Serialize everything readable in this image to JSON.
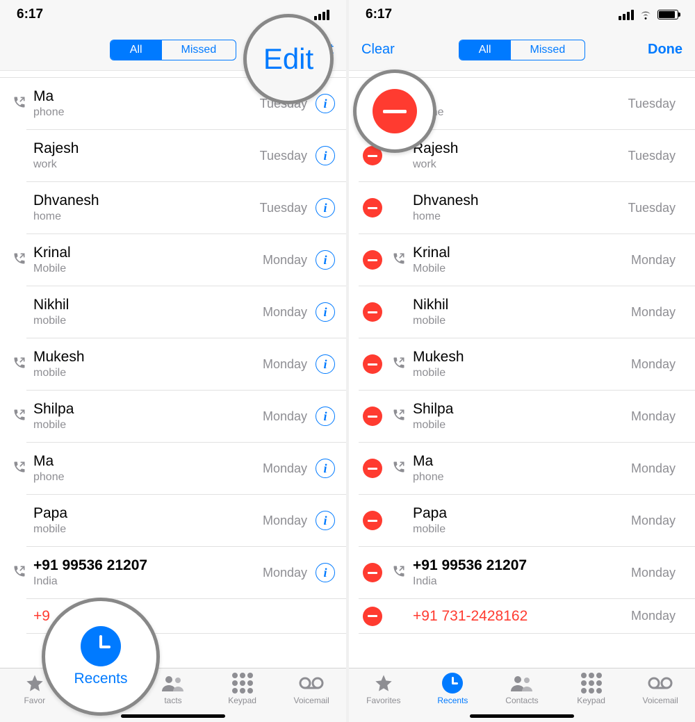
{
  "left": {
    "time": "6:17",
    "header": {
      "edit": "Edit",
      "seg_all": "All",
      "seg_missed": "Missed"
    },
    "rows": [
      {
        "name": "Ma",
        "sub": "phone",
        "day": "Tuesday",
        "icon": true,
        "missed": false,
        "info": true
      },
      {
        "name": "Rajesh",
        "sub": "work",
        "day": "Tuesday",
        "icon": false,
        "missed": false,
        "info": true
      },
      {
        "name": "Dhvanesh",
        "sub": "home",
        "day": "Tuesday",
        "icon": false,
        "missed": false,
        "info": true
      },
      {
        "name": "Krinal",
        "sub": "Mobile",
        "day": "Monday",
        "icon": true,
        "missed": false,
        "info": true
      },
      {
        "name": "Nikhil",
        "sub": "mobile",
        "day": "Monday",
        "icon": false,
        "missed": false,
        "info": true
      },
      {
        "name": "Mukesh",
        "sub": "mobile",
        "day": "Monday",
        "icon": true,
        "missed": false,
        "info": true
      },
      {
        "name": "Shilpa",
        "sub": "mobile",
        "day": "Monday",
        "icon": true,
        "missed": false,
        "info": true
      },
      {
        "name": "Ma",
        "sub": "phone",
        "day": "Monday",
        "icon": true,
        "missed": false,
        "info": true
      },
      {
        "name": "Papa",
        "sub": "mobile",
        "day": "Monday",
        "icon": false,
        "missed": false,
        "info": true
      },
      {
        "name": "+91 99536 21207",
        "sub": "India",
        "day": "Monday",
        "icon": true,
        "missed": false,
        "bold": true,
        "info": true
      },
      {
        "name": "+9",
        "sub": "",
        "day": "",
        "icon": false,
        "missed": true,
        "partial": true
      }
    ],
    "tabs": {
      "favorites": "Favor",
      "recents": "Recents",
      "contacts": "tacts",
      "keypad": "Keypad",
      "voicemail": "Voicemail"
    }
  },
  "right": {
    "time": "6:17",
    "header": {
      "clear": "Clear",
      "done": "Done",
      "seg_all": "All",
      "seg_missed": "Missed"
    },
    "rows": [
      {
        "name": "Ma",
        "sub": "phone",
        "day": "Tuesday",
        "icon": true,
        "remain": true
      },
      {
        "name": "Rajesh",
        "sub": "work",
        "day": "Tuesday",
        "icon": false
      },
      {
        "name": "Dhvanesh",
        "sub": "home",
        "day": "Tuesday",
        "icon": false
      },
      {
        "name": "Krinal",
        "sub": "Mobile",
        "day": "Monday",
        "icon": true
      },
      {
        "name": "Nikhil",
        "sub": "mobile",
        "day": "Monday",
        "icon": false
      },
      {
        "name": "Mukesh",
        "sub": "mobile",
        "day": "Monday",
        "icon": true
      },
      {
        "name": "Shilpa",
        "sub": "mobile",
        "day": "Monday",
        "icon": true
      },
      {
        "name": "Ma",
        "sub": "phone",
        "day": "Monday",
        "icon": true
      },
      {
        "name": "Papa",
        "sub": "mobile",
        "day": "Monday",
        "icon": false
      },
      {
        "name": "+91 99536 21207",
        "sub": "India",
        "day": "Monday",
        "icon": true,
        "bold": true
      },
      {
        "name": "+91 731-2428162",
        "sub": "",
        "day": "Monday",
        "icon": false,
        "missed": true,
        "partial": true
      }
    ],
    "tabs": {
      "favorites": "Favorites",
      "recents": "Recents",
      "contacts": "Contacts",
      "keypad": "Keypad",
      "voicemail": "Voicemail"
    }
  },
  "callouts": {
    "edit": "Edit",
    "recents": "Recents"
  }
}
